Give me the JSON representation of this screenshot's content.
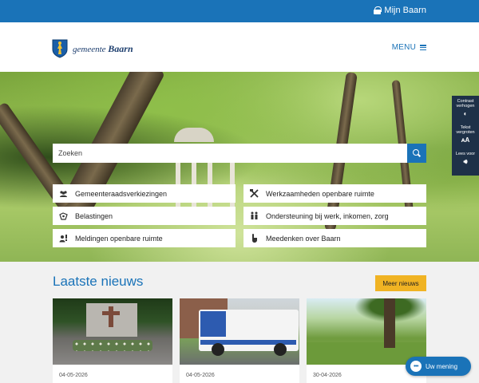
{
  "topbar": {
    "account_label": "Mijn Baarn"
  },
  "header": {
    "logo_prefix": "gemeente",
    "logo_name": "Baarn",
    "menu_label": "MENU"
  },
  "search": {
    "placeholder": "Zoeken"
  },
  "quick_links": [
    {
      "label": "Gemeenteraadsverkiezingen",
      "icon": "people-icon"
    },
    {
      "label": "Werkzaamheden openbare ruimte",
      "icon": "tools-icon"
    },
    {
      "label": "Belastingen",
      "icon": "money-icon"
    },
    {
      "label": "Ondersteuning bij werk, inkomen, zorg",
      "icon": "support-icon"
    },
    {
      "label": "Meldingen openbare ruimte",
      "icon": "report-icon"
    },
    {
      "label": "Meedenken over Baarn",
      "icon": "hand-icon"
    }
  ],
  "accessibility": [
    {
      "label_line1": "Contrast",
      "label_line2": "verhogen",
      "icon_text": "◐"
    },
    {
      "label_line1": "Tekst",
      "label_line2": "vergroten",
      "icon_text": "ᴀA"
    },
    {
      "label_line1": "Lees voor",
      "label_line2": "",
      "icon_text": "🔊︎"
    }
  ],
  "news": {
    "title": "Laatste nieuws",
    "more_label": "Meer nieuws",
    "items": [
      {
        "date": "04-05-2026",
        "image": "memorial-wreaths"
      },
      {
        "date": "04-05-2026",
        "image": "street-sweeper-truck"
      },
      {
        "date": "30-04-2026",
        "image": "park-trees"
      }
    ]
  },
  "chat": {
    "label": "Uw mening",
    "icon_text": "•••"
  },
  "colors": {
    "primary": "#1a73b8",
    "accent": "#f0b323",
    "panel": "#1e3148"
  }
}
